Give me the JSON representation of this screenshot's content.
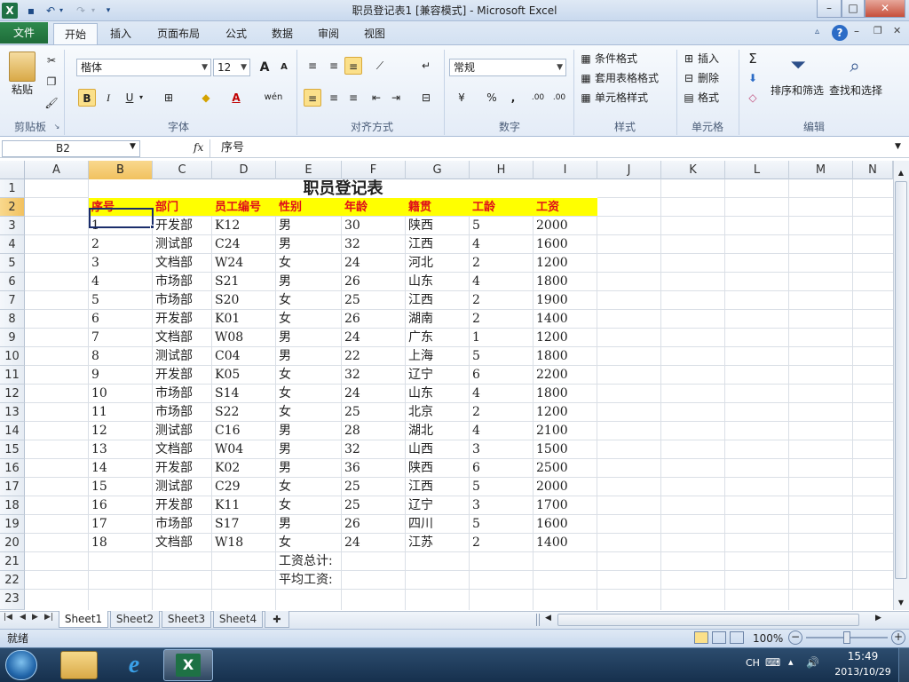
{
  "window": {
    "title": "职员登记表1  [兼容模式]  -  Microsoft Excel",
    "app_icon": "X",
    "min": "–",
    "max": "□",
    "close": "✕"
  },
  "tabs": [
    "文件",
    "开始",
    "插入",
    "页面布局",
    "公式",
    "数据",
    "审阅",
    "视图"
  ],
  "ribbon": {
    "clipboard": {
      "paste": "粘贴",
      "label": "剪贴板"
    },
    "font": {
      "name": "楷体",
      "size": "12",
      "bold": "B",
      "italic": "I",
      "underline": "U",
      "grow": "A",
      "shrink": "A",
      "font_color": "A",
      "wen": "wén",
      "label": "字体"
    },
    "alignment": {
      "label": "对齐方式"
    },
    "number": {
      "format": "常规",
      "percent": "%",
      "comma": ",",
      "inc": ".00",
      "dec": ".00",
      "label": "数字"
    },
    "styles": {
      "cond": "条件格式",
      "table": "套用表格格式",
      "cell": "单元格样式",
      "label": "样式"
    },
    "cells": {
      "insert": "插入",
      "delete": "删除",
      "format": "格式",
      "label": "单元格"
    },
    "editing": {
      "sum": "Σ",
      "sort": "排序和筛选",
      "find": "查找和选择",
      "label": "编辑"
    }
  },
  "formula_bar": {
    "name_box": "B2",
    "fx": "fx",
    "value": "序号"
  },
  "columns": [
    "A",
    "B",
    "C",
    "D",
    "E",
    "F",
    "G",
    "H",
    "I",
    "J",
    "K",
    "L",
    "M",
    "N"
  ],
  "rows": [
    "1",
    "2",
    "3",
    "4",
    "5",
    "6",
    "7",
    "8",
    "9",
    "10",
    "11",
    "12",
    "13",
    "14",
    "15",
    "16",
    "17",
    "18",
    "19",
    "20",
    "21",
    "22",
    "23"
  ],
  "sheet": {
    "title": "职员登记表",
    "headers": [
      "序号",
      "部门",
      "员工编号",
      "性别",
      "年龄",
      "籍贯",
      "工龄",
      "工资"
    ],
    "data": [
      [
        "1",
        "开发部",
        "K12",
        "男",
        "30",
        "陕西",
        "5",
        "2000"
      ],
      [
        "2",
        "测试部",
        "C24",
        "男",
        "32",
        "江西",
        "4",
        "1600"
      ],
      [
        "3",
        "文档部",
        "W24",
        "女",
        "24",
        "河北",
        "2",
        "1200"
      ],
      [
        "4",
        "市场部",
        "S21",
        "男",
        "26",
        "山东",
        "4",
        "1800"
      ],
      [
        "5",
        "市场部",
        "S20",
        "女",
        "25",
        "江西",
        "2",
        "1900"
      ],
      [
        "6",
        "开发部",
        "K01",
        "女",
        "26",
        "湖南",
        "2",
        "1400"
      ],
      [
        "7",
        "文档部",
        "W08",
        "男",
        "24",
        "广东",
        "1",
        "1200"
      ],
      [
        "8",
        "测试部",
        "C04",
        "男",
        "22",
        "上海",
        "5",
        "1800"
      ],
      [
        "9",
        "开发部",
        "K05",
        "女",
        "32",
        "辽宁",
        "6",
        "2200"
      ],
      [
        "10",
        "市场部",
        "S14",
        "女",
        "24",
        "山东",
        "4",
        "1800"
      ],
      [
        "11",
        "市场部",
        "S22",
        "女",
        "25",
        "北京",
        "2",
        "1200"
      ],
      [
        "12",
        "测试部",
        "C16",
        "男",
        "28",
        "湖北",
        "4",
        "2100"
      ],
      [
        "13",
        "文档部",
        "W04",
        "男",
        "32",
        "山西",
        "3",
        "1500"
      ],
      [
        "14",
        "开发部",
        "K02",
        "男",
        "36",
        "陕西",
        "6",
        "2500"
      ],
      [
        "15",
        "测试部",
        "C29",
        "女",
        "25",
        "江西",
        "5",
        "2000"
      ],
      [
        "16",
        "开发部",
        "K11",
        "女",
        "25",
        "辽宁",
        "3",
        "1700"
      ],
      [
        "17",
        "市场部",
        "S17",
        "男",
        "26",
        "四川",
        "5",
        "1600"
      ],
      [
        "18",
        "文档部",
        "W18",
        "女",
        "24",
        "江苏",
        "2",
        "1400"
      ]
    ],
    "total_label": "工资总计:",
    "avg_label": "平均工资:"
  },
  "sheet_tabs": [
    "Sheet1",
    "Sheet2",
    "Sheet3",
    "Sheet4"
  ],
  "status": {
    "ready": "就绪",
    "zoom": "100%"
  },
  "taskbar": {
    "lang": "CH",
    "time": "15:49",
    "date": "2013/10/29"
  }
}
